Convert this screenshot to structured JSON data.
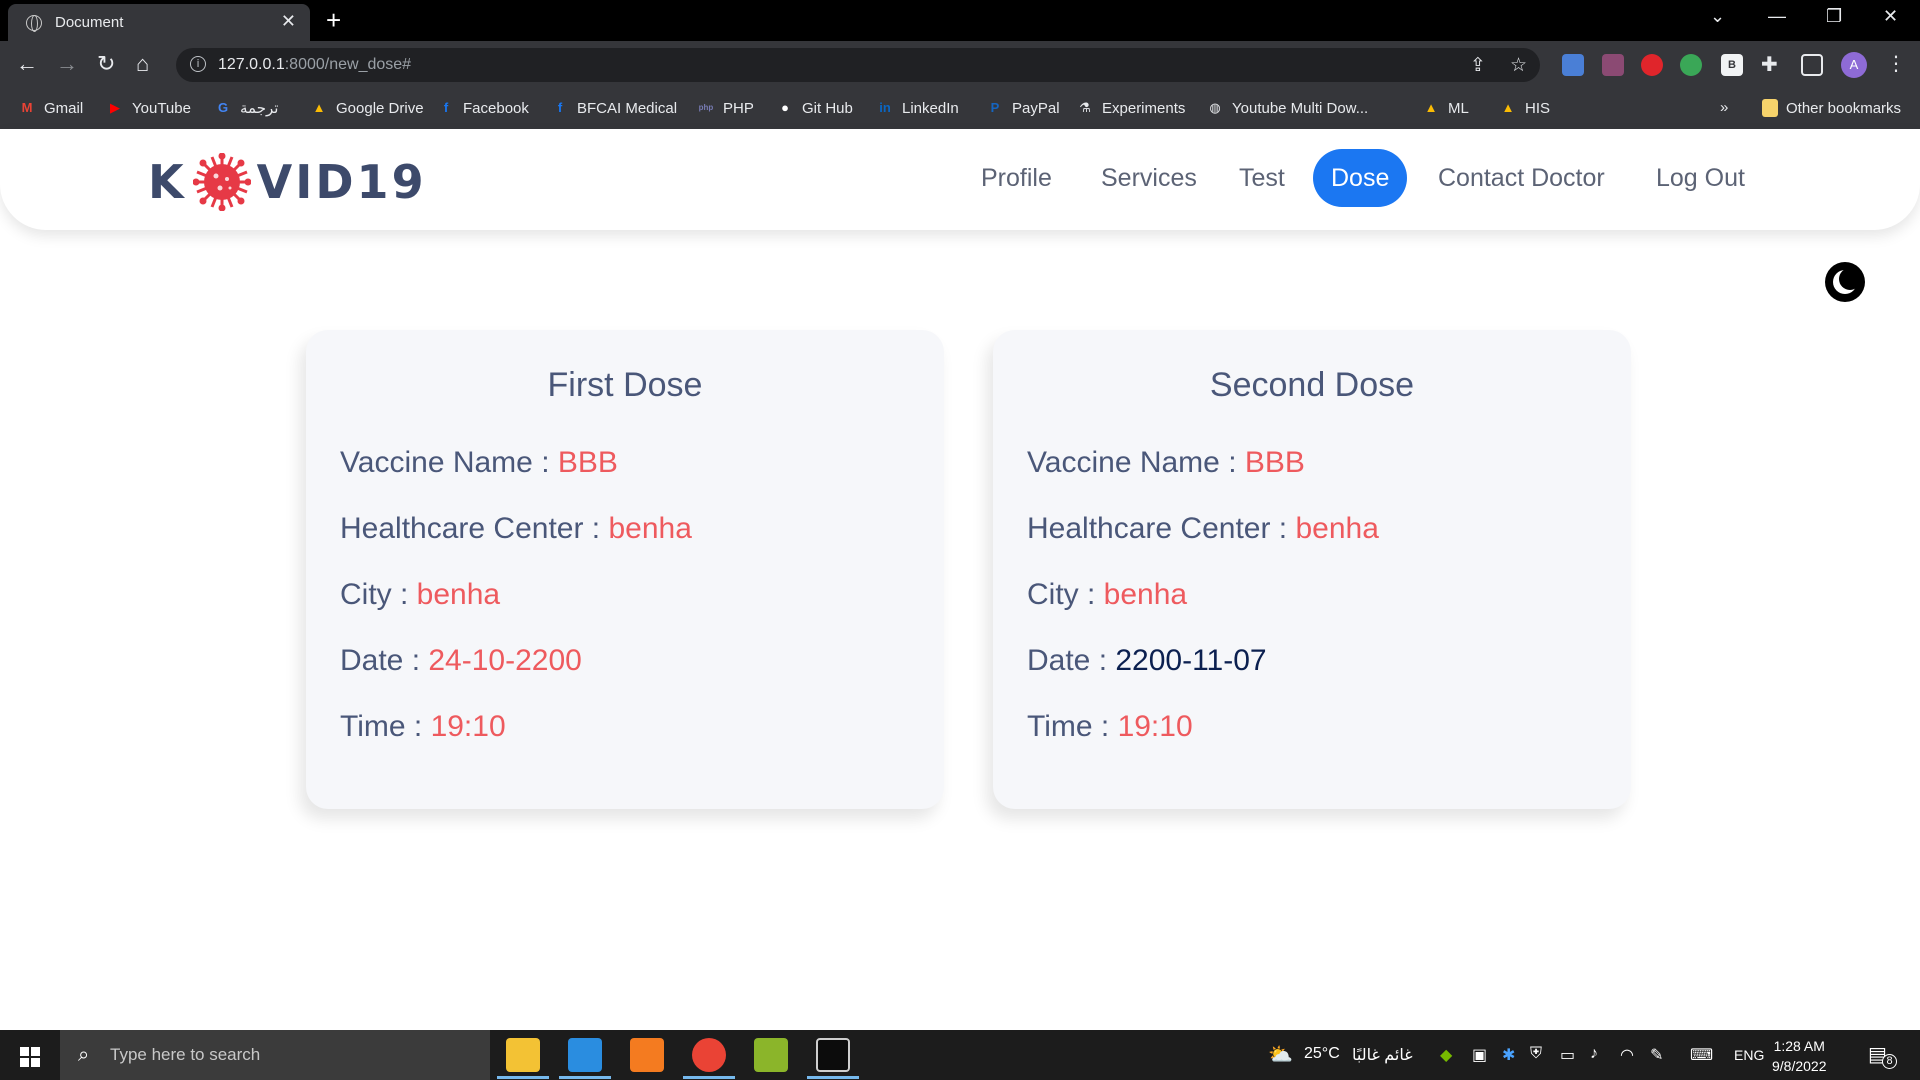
{
  "browser": {
    "tab_title": "Document",
    "tab_close": "✕",
    "new_tab": "+",
    "url_host": "127.0.0.1",
    "url_rest": ":8000/new_dose#",
    "bookmarks": [
      {
        "label": "Gmail",
        "icon": "gmail-icon",
        "color": "#ea4335"
      },
      {
        "label": "YouTube",
        "icon": "youtube-icon",
        "color": "#ff0000"
      },
      {
        "label": "ترجمة",
        "icon": "translate-icon",
        "color": "#4285f4"
      },
      {
        "label": "Google Drive",
        "icon": "drive-icon",
        "color": "#fbbc04"
      },
      {
        "label": "Facebook",
        "icon": "facebook-icon",
        "color": "#1877f2"
      },
      {
        "label": "BFCAI Medical",
        "icon": "facebook-icon",
        "color": "#1877f2"
      },
      {
        "label": "PHP",
        "icon": "php-icon",
        "color": "#777bb3"
      },
      {
        "label": "Git Hub",
        "icon": "github-icon",
        "color": "#ffffff"
      },
      {
        "label": "LinkedIn",
        "icon": "linkedin-icon",
        "color": "#0a66c2"
      },
      {
        "label": "PayPal",
        "icon": "paypal-icon",
        "color": "#1565c0"
      },
      {
        "label": "Experiments",
        "icon": "flask-icon",
        "color": "#e8eaed"
      },
      {
        "label": "Youtube Multi Dow...",
        "icon": "globe-icon",
        "color": "#e8eaed"
      },
      {
        "label": "ML",
        "icon": "drive-icon",
        "color": "#fbbc04"
      },
      {
        "label": "HIS",
        "icon": "drive-icon",
        "color": "#fbbc04"
      }
    ],
    "more_bookmarks": "»",
    "other_bookmarks": "Other bookmarks",
    "profile_initial": "A"
  },
  "site": {
    "logo_left": "K",
    "logo_right": "VID19",
    "nav": [
      "Profile",
      "Services",
      "Test",
      "Dose",
      "Contact Doctor",
      "Log Out"
    ],
    "active_nav": "Dose",
    "accent": "#1b77f2"
  },
  "doses": [
    {
      "title": "First Dose",
      "fields": [
        {
          "label": "Vaccine Name : ",
          "value": "BBB"
        },
        {
          "label": "Healthcare Center : ",
          "value": "benha"
        },
        {
          "label": "City : ",
          "value": "benha"
        },
        {
          "label": "Date : ",
          "value": "24-10-2200"
        },
        {
          "label": "Time : ",
          "value": "19:10"
        }
      ]
    },
    {
      "title": "Second Dose",
      "fields": [
        {
          "label": "Vaccine Name : ",
          "value": "BBB"
        },
        {
          "label": "Healthcare Center : ",
          "value": "benha"
        },
        {
          "label": "City : ",
          "value": "benha"
        },
        {
          "label": "Date : ",
          "value": "2200-11-07"
        },
        {
          "label": "Time : ",
          "value": "19:10"
        }
      ]
    }
  ],
  "taskbar": {
    "search_placeholder": "Type here to search",
    "weather": "25°C",
    "weather_text": "غائم غالبًا",
    "lang": "ENG",
    "time": "1:28 AM",
    "date": "9/8/2022",
    "notifications": "8"
  }
}
